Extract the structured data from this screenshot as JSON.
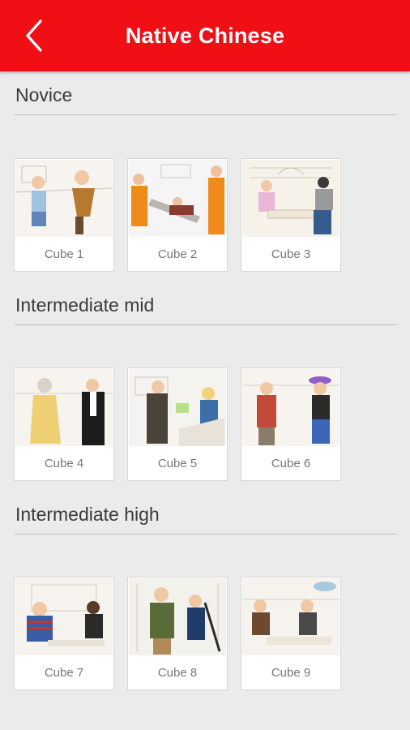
{
  "header": {
    "title": "Native Chinese",
    "back_icon": "chevron-left-icon"
  },
  "colors": {
    "accent": "#ef0f14",
    "background": "#ebebeb"
  },
  "sections": [
    {
      "title": "Novice",
      "cubes": [
        {
          "label": "Cube 1"
        },
        {
          "label": "Cube 2"
        },
        {
          "label": "Cube 3"
        }
      ]
    },
    {
      "title": "Intermediate mid",
      "cubes": [
        {
          "label": "Cube 4"
        },
        {
          "label": "Cube 5"
        },
        {
          "label": "Cube 6"
        }
      ]
    },
    {
      "title": "Intermediate high",
      "cubes": [
        {
          "label": "Cube 7"
        },
        {
          "label": "Cube 8"
        },
        {
          "label": "Cube 9"
        }
      ]
    }
  ]
}
